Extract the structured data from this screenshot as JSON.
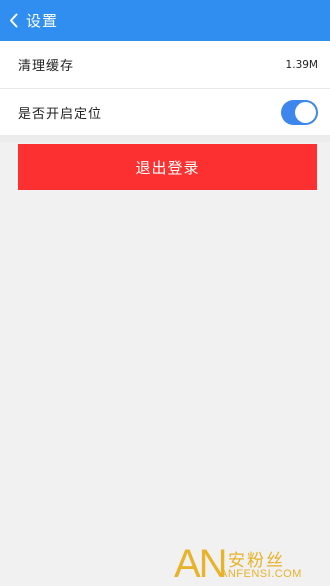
{
  "header": {
    "title": "设置",
    "back_icon": "chevron-left-icon",
    "background_color": "#2f8ef0"
  },
  "settings": {
    "clear_cache": {
      "label": "清理缓存",
      "value": "1.39M"
    },
    "location": {
      "label": "是否开启定位",
      "enabled": true,
      "toggle_color": "#3d86ee"
    }
  },
  "logout": {
    "label": "退出登录",
    "background_color": "#fc3030"
  },
  "watermark": {
    "logo_text": "AN",
    "chinese_text": "安粉丝",
    "english_text": "ANFENSI.COM",
    "color": "#e8b32a"
  }
}
